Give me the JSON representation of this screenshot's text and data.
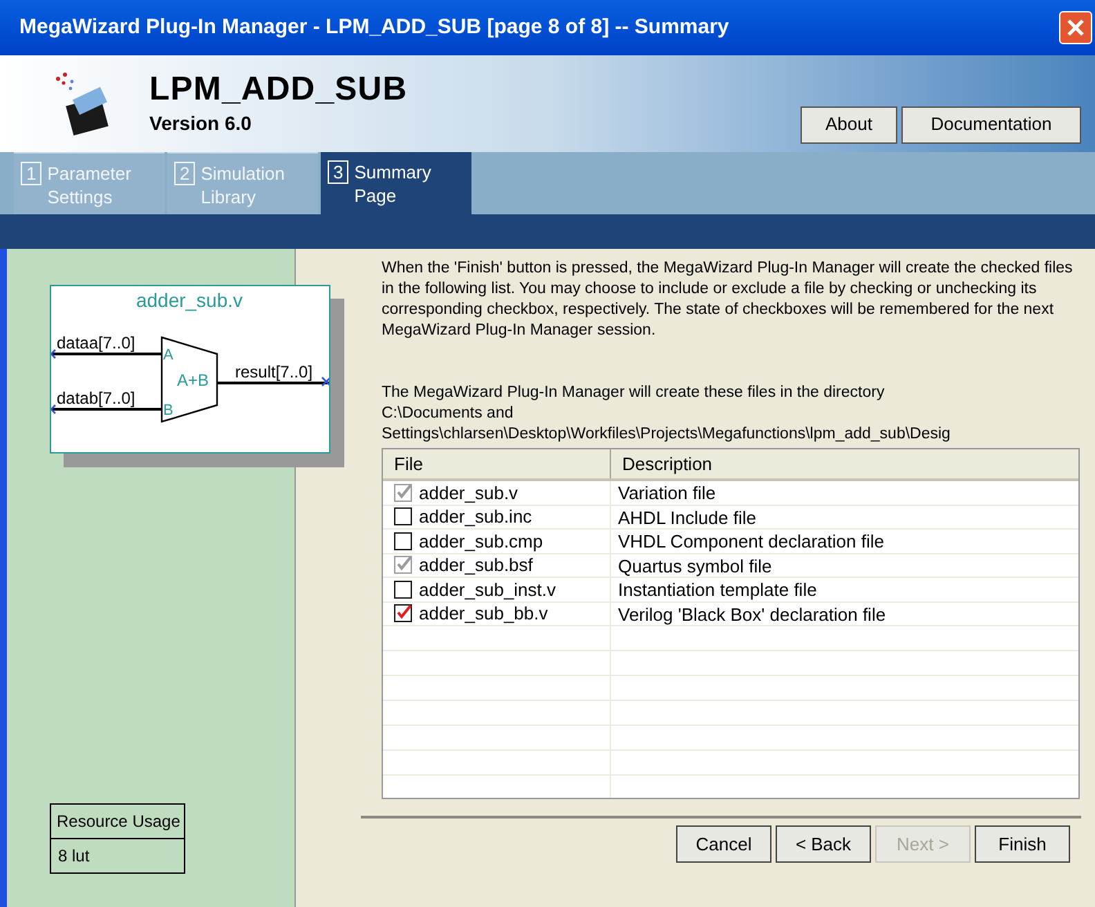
{
  "window": {
    "title": "MegaWizard Plug-In Manager - LPM_ADD_SUB [page 8 of 8] -- Summary"
  },
  "header": {
    "title": "LPM_ADD_SUB",
    "version": "Version 6.0",
    "buttons": [
      "About",
      "Documentation"
    ]
  },
  "tabs": [
    {
      "number": "1",
      "label": "Parameter Settings",
      "selected": false
    },
    {
      "number": "2",
      "label": "Simulation Library",
      "selected": false
    },
    {
      "number": "3",
      "label": "Summary Page",
      "selected": true
    }
  ],
  "symbol": {
    "title": "adder_sub.v",
    "inputs": [
      {
        "name": "dataa[7..0]",
        "pin": "A"
      },
      {
        "name": "datab[7..0]",
        "pin": "B"
      }
    ],
    "operation": "A+B",
    "output": "result[7..0]"
  },
  "resource_usage": {
    "heading": "Resource Usage",
    "value": "8 lut"
  },
  "intro": "When the 'Finish' button is pressed, the MegaWizard Plug-In Manager will create the checked files in the following list. You may choose to include or exclude a file by checking or unchecking its corresponding checkbox, respectively. The state of checkboxes will be remembered for the next MegaWizard Plug-In Manager session.",
  "directory_note": "The MegaWizard Plug-In Manager will create these files in the directory",
  "directory_lines": [
    "C:\\Documents and",
    "Settings\\chlarsen\\Desktop\\Workfiles\\Projects\\Megafunctions\\lpm_add_sub\\Desig"
  ],
  "table": {
    "columns": [
      "File",
      "Description"
    ],
    "rows": [
      {
        "file": "adder_sub.v",
        "description": "Variation file",
        "checked": true,
        "disabled": true
      },
      {
        "file": "adder_sub.inc",
        "description": "AHDL Include file",
        "checked": false,
        "disabled": false
      },
      {
        "file": "adder_sub.cmp",
        "description": "VHDL Component declaration file",
        "checked": false,
        "disabled": false
      },
      {
        "file": "adder_sub.bsf",
        "description": "Quartus symbol file",
        "checked": true,
        "disabled": true
      },
      {
        "file": "adder_sub_inst.v",
        "description": "Instantiation template file",
        "checked": false,
        "disabled": false
      },
      {
        "file": "adder_sub_bb.v",
        "description": "Verilog 'Black Box' declaration file",
        "checked": true,
        "disabled": false
      }
    ]
  },
  "footer_buttons": [
    {
      "label": "Cancel",
      "disabled": false
    },
    {
      "label": "< Back",
      "disabled": false
    },
    {
      "label": "Next >",
      "disabled": true
    },
    {
      "label": "Finish",
      "disabled": false
    }
  ]
}
